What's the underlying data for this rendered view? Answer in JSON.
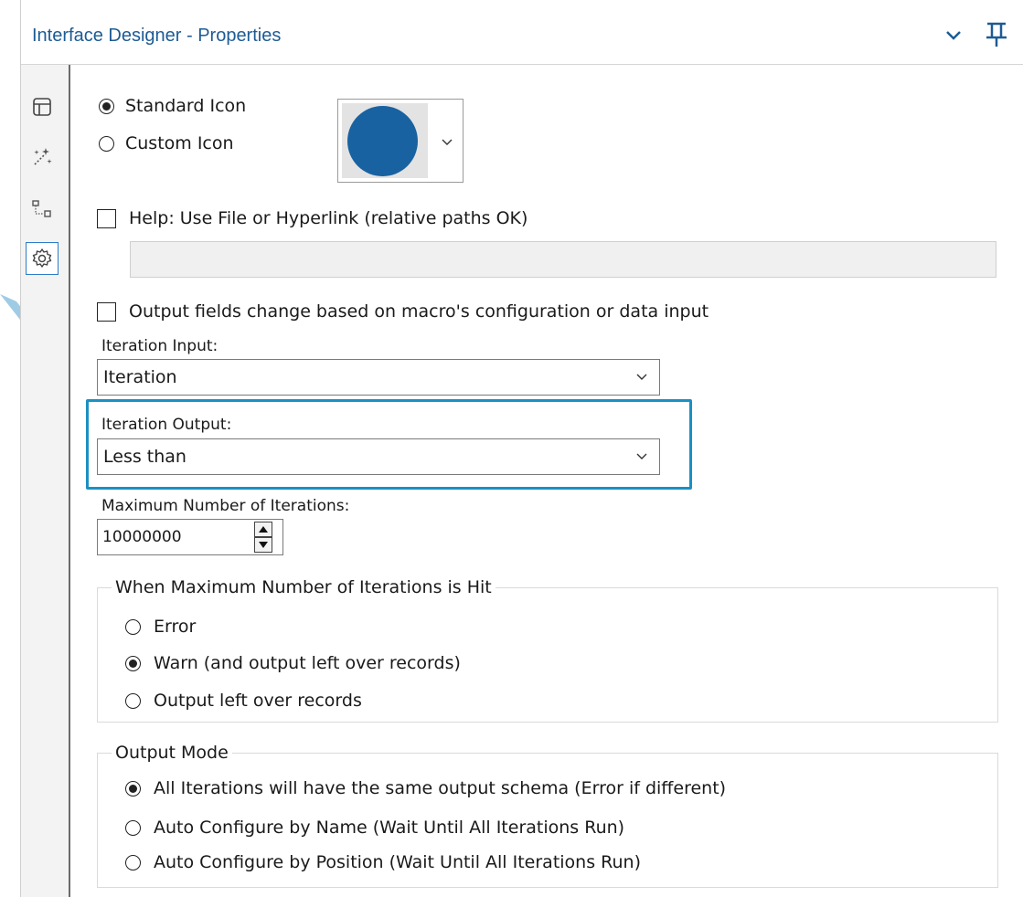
{
  "panel": {
    "title": "Interface Designer - Properties"
  },
  "icon_selection": {
    "standard_label": "Standard Icon",
    "custom_label": "Custom Icon",
    "icon_color": "#1862a1"
  },
  "help": {
    "label": "Help: Use File or Hyperlink (relative paths OK)",
    "value": ""
  },
  "output_fields": {
    "label": "Output fields change based on macro's configuration or data input"
  },
  "iteration_input": {
    "label": "Iteration Input:",
    "value": "Iteration"
  },
  "iteration_output": {
    "label": "Iteration Output:",
    "value": "Less than"
  },
  "max_iterations": {
    "label": "Maximum Number of Iterations:",
    "value": "10000000"
  },
  "max_hit_group": {
    "title": "When Maximum Number of Iterations is Hit",
    "options": [
      "Error",
      "Warn (and output left over records)",
      "Output left over records"
    ],
    "selected": "Warn (and output left over records)"
  },
  "output_mode_group": {
    "title": "Output Mode",
    "options": [
      "All Iterations will have the same output schema (Error if different)",
      "Auto Configure by Name (Wait Until All Iterations Run)",
      "Auto Configure by Position (Wait Until All Iterations Run)"
    ],
    "selected": "All Iterations will have the same output schema (Error if different)"
  },
  "colors": {
    "accent": "#1d5b94",
    "highlight": "#1b90c2",
    "pointer": "#7fb9dc"
  }
}
